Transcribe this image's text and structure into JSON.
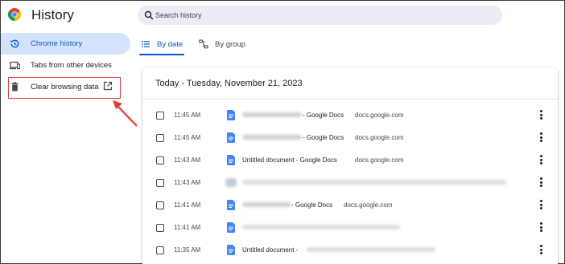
{
  "app": {
    "title": "History"
  },
  "search": {
    "placeholder": "Search history"
  },
  "sidebar": {
    "items": [
      {
        "label": "Chrome history",
        "icon": "history-icon",
        "active": true
      },
      {
        "label": "Tabs from other devices",
        "icon": "devices-icon",
        "active": false
      },
      {
        "label": "Clear browsing data",
        "icon": "trash-icon",
        "active": false
      }
    ]
  },
  "tabs": [
    {
      "label": "By date",
      "icon": "list-icon",
      "active": true
    },
    {
      "label": "By group",
      "icon": "group-icon",
      "active": false
    }
  ],
  "history": {
    "section_title": "Today - Tuesday, November 21, 2023",
    "rows": [
      {
        "time": "11:45 AM",
        "title": " - Google Docs",
        "domain": "docs.google.com"
      },
      {
        "time": "11:45 AM",
        "title": " - Google Docs",
        "domain": "docs.google.com"
      },
      {
        "time": "11:43 AM",
        "title": "Untitled document - Google Docs",
        "domain": "docs.google.com"
      },
      {
        "time": "11:43 AM",
        "title": "",
        "domain": ""
      },
      {
        "time": "11:41 AM",
        "title": " - Google Docs",
        "domain": "docs.google.com"
      },
      {
        "time": "11:41 AM",
        "title": "",
        "domain": ""
      },
      {
        "time": "11:35 AM",
        "title": "Untitled document - ",
        "domain": ""
      }
    ]
  },
  "colors": {
    "accent": "#0b57d0",
    "active_bg": "#d3e3fd",
    "search_bg": "#e9eef6",
    "highlight": "#e53935",
    "docs_blue": "#4285f4"
  }
}
